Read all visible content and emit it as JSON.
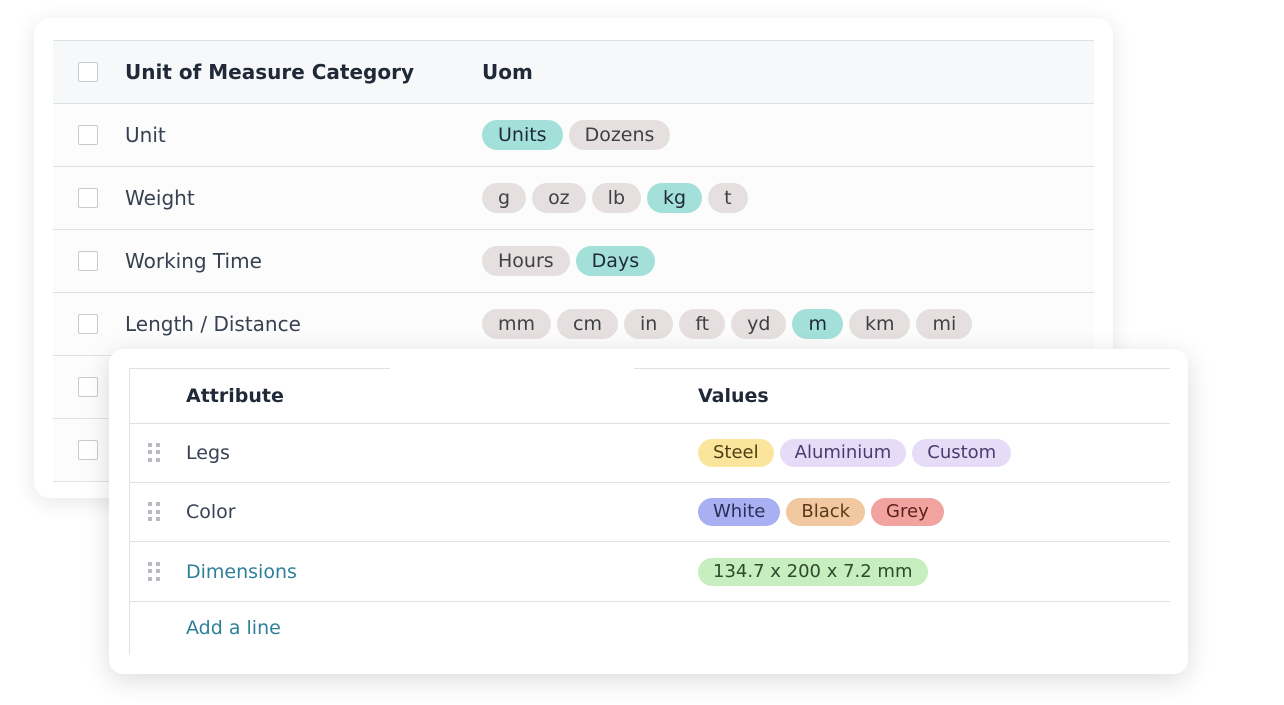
{
  "uom_list": {
    "header": {
      "category": "Unit of Measure Category",
      "uom": "Uom"
    },
    "rows": [
      {
        "category": "Unit",
        "units": [
          {
            "label": "Units",
            "active": true
          },
          {
            "label": "Dozens",
            "active": false
          }
        ]
      },
      {
        "category": "Weight",
        "units": [
          {
            "label": "g",
            "active": false
          },
          {
            "label": "oz",
            "active": false
          },
          {
            "label": "lb",
            "active": false
          },
          {
            "label": "kg",
            "active": true
          },
          {
            "label": "t",
            "active": false
          }
        ]
      },
      {
        "category": "Working Time",
        "units": [
          {
            "label": "Hours",
            "active": false
          },
          {
            "label": "Days",
            "active": true
          }
        ]
      },
      {
        "category": "Length / Distance",
        "units": [
          {
            "label": "mm",
            "active": false
          },
          {
            "label": "cm",
            "active": false
          },
          {
            "label": "in",
            "active": false
          },
          {
            "label": "ft",
            "active": false
          },
          {
            "label": "yd",
            "active": false
          },
          {
            "label": "m",
            "active": true
          },
          {
            "label": "km",
            "active": false
          },
          {
            "label": "mi",
            "active": false
          }
        ]
      }
    ],
    "hidden_rows": 2
  },
  "attributes": {
    "header": {
      "attribute": "Attribute",
      "values": "Values"
    },
    "rows": [
      {
        "name": "Legs",
        "link": false,
        "values": [
          {
            "label": "Steel",
            "bg": "#fbe49b",
            "fg": "#4b3f12"
          },
          {
            "label": "Aluminium",
            "bg": "#e7dcf7",
            "fg": "#4c3b6e"
          },
          {
            "label": "Custom",
            "bg": "#e7dcf7",
            "fg": "#4c3b6e"
          }
        ]
      },
      {
        "name": "Color",
        "link": false,
        "values": [
          {
            "label": "White",
            "bg": "#a9b0f2",
            "fg": "#2b2f5a"
          },
          {
            "label": "Black",
            "bg": "#f1c89f",
            "fg": "#5a3a1c"
          },
          {
            "label": "Grey",
            "bg": "#f2a3a0",
            "fg": "#5a2220"
          }
        ]
      },
      {
        "name": "Dimensions",
        "link": true,
        "values": [
          {
            "label": "134.7 x 200 x 7.2 mm",
            "bg": "#c6eebf",
            "fg": "#2f4a2a"
          }
        ]
      }
    ],
    "add_line": "Add a line"
  },
  "colors": {
    "active_tag": "#a3e0da",
    "inactive_tag": "#e5e0df",
    "link": "#2f7f9a",
    "add_line": "#2f7f9a"
  }
}
